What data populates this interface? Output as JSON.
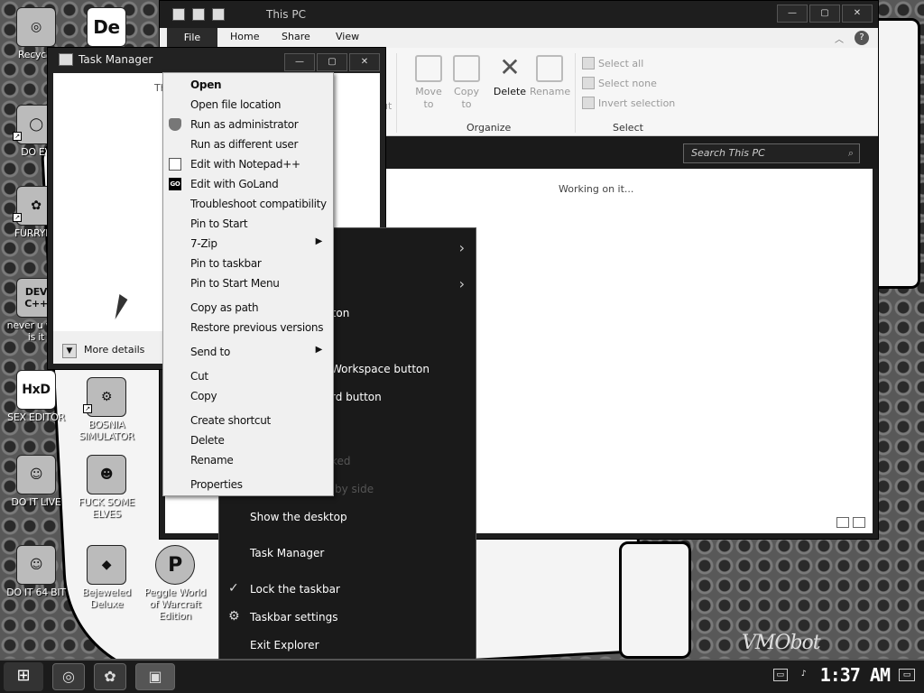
{
  "desktop": {
    "icons": [
      {
        "label": "Recycle",
        "glyph": "◎"
      },
      {
        "label": "DO EV",
        "glyph": "◯"
      },
      {
        "label": "FURRYFU",
        "glyph": "✿"
      },
      {
        "label": "never u why is it",
        "glyph": "DEV C++"
      },
      {
        "label": "SEX EDITOR",
        "glyph": "HxD"
      },
      {
        "label": "DO IT LIVE",
        "glyph": "☺"
      },
      {
        "label": "DO IT 64 BIT",
        "glyph": "☺"
      },
      {
        "label": "BOSNIA SIMULATOR",
        "glyph": "⚙"
      },
      {
        "label": "FUCK SOME ELVES",
        "glyph": "☻"
      },
      {
        "label": "Bejeweled Deluxe",
        "glyph": "◆"
      },
      {
        "label": "Peggle World of Warcraft Edition",
        "glyph": "P"
      },
      {
        "label": "De",
        "glyph": "De"
      }
    ],
    "watermark": "VMObot"
  },
  "explorer": {
    "title": "This PC",
    "tabs": [
      "File",
      "Home",
      "Share",
      "View"
    ],
    "ribbon": {
      "move_to": "Move to",
      "copy_to": "Copy to",
      "delete": "Delete",
      "rename": "Rename",
      "organize": "Organize",
      "select_all": "Select all",
      "select_none": "Select none",
      "invert_selection": "Invert selection",
      "select_group": "Select",
      "cut_fragment": "ut"
    },
    "search_placeholder": "Search This PC",
    "status": "Working on it..."
  },
  "task_manager": {
    "title": "Task Manager",
    "loading_fragment": "Th",
    "more_details": "More details"
  },
  "context_menu": {
    "items": [
      {
        "label": "Open",
        "bold": true
      },
      {
        "label": "Open file location"
      },
      {
        "label": "Run as administrator",
        "icon": "shield-icon"
      },
      {
        "label": "Run as different user"
      },
      {
        "label": "Edit with Notepad++",
        "icon": "notepadpp-icon"
      },
      {
        "label": "Edit with GoLand",
        "icon": "goland-icon"
      },
      {
        "label": "Troubleshoot compatibility"
      },
      {
        "label": "Pin to Start"
      },
      {
        "label": "7-Zip",
        "submenu": true
      },
      {
        "label": "Pin to taskbar"
      },
      {
        "label": "Pin to Start Menu"
      },
      {
        "label": "Copy as path"
      },
      {
        "label": "Restore previous versions"
      },
      {
        "label": "Send to",
        "submenu": true
      },
      {
        "label": "Cut"
      },
      {
        "label": "Copy"
      },
      {
        "label": "Create shortcut"
      },
      {
        "label": "Delete"
      },
      {
        "label": "Rename"
      },
      {
        "label": "Properties"
      }
    ]
  },
  "taskbar_menu": {
    "items": [
      {
        "label": "",
        "submenu": true
      },
      {
        "label": "",
        "submenu": true
      },
      {
        "label": "tton"
      },
      {
        "label": "Workspace button"
      },
      {
        "label": "rd button"
      },
      {
        "label": "ked",
        "dim": true
      },
      {
        "label": "by side",
        "dim": true
      },
      {
        "label": "Show the desktop"
      },
      {
        "label": "Task Manager"
      },
      {
        "label": "Lock the taskbar",
        "checked": true
      },
      {
        "label": "Taskbar settings",
        "gear": true
      },
      {
        "label": "Exit Explorer"
      }
    ]
  },
  "taskbar": {
    "clock": "1:37 AM"
  }
}
